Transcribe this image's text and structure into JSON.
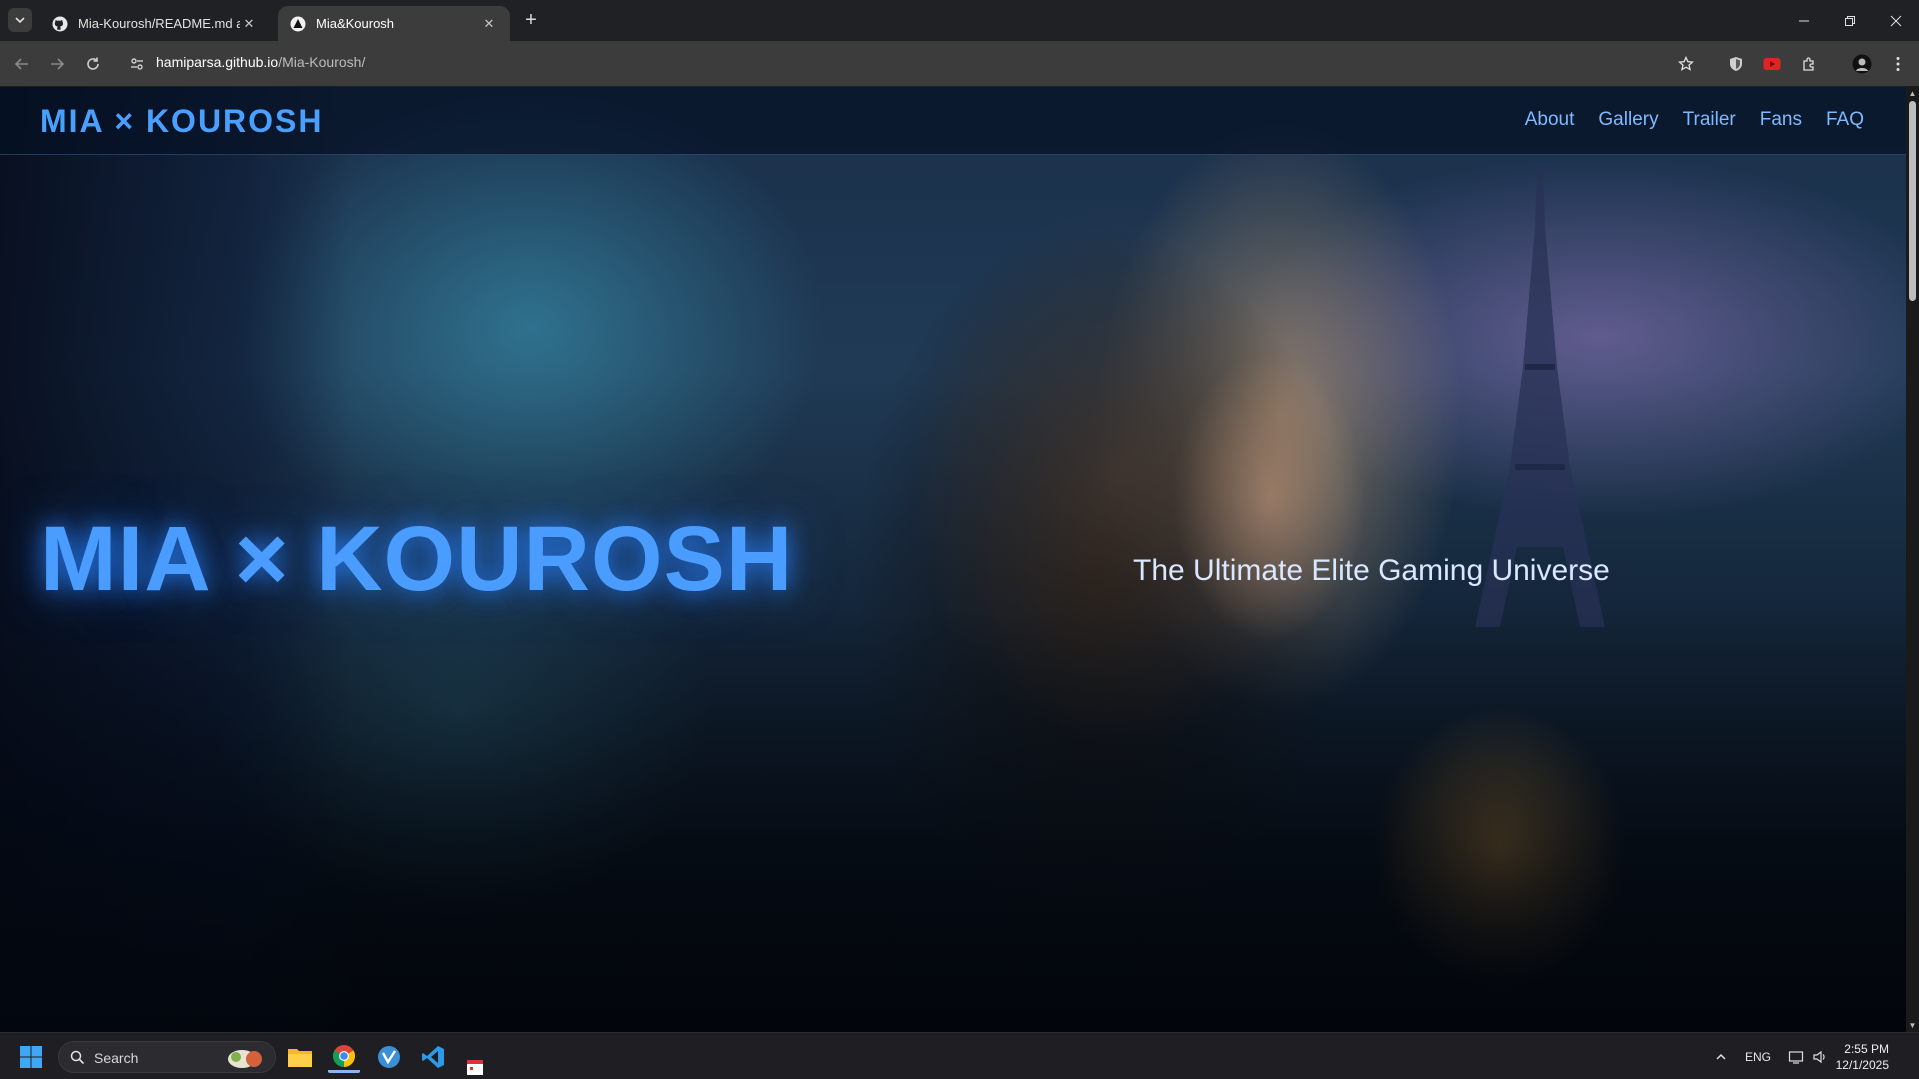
{
  "browser": {
    "tabs": [
      {
        "title": "Mia-Kourosh/README.md at m",
        "icon": "github-icon",
        "active": false
      },
      {
        "title": "Mia&Kourosh",
        "icon": "site-favicon-icon",
        "active": true
      }
    ],
    "new_tab_label": "+",
    "address": {
      "host": "hamiparsa.github.io",
      "path": "/Mia-Kourosh/"
    }
  },
  "site": {
    "logo": "MIA × KOUROSH",
    "nav": [
      {
        "label": "About"
      },
      {
        "label": "Gallery"
      },
      {
        "label": "Trailer"
      },
      {
        "label": "Fans"
      },
      {
        "label": "FAQ"
      }
    ],
    "hero": {
      "title": "MIA × KOUROSH",
      "tagline": "The Ultimate Elite Gaming Universe"
    },
    "accent_color": "#4a9dff"
  },
  "taskbar": {
    "search_placeholder": "Search",
    "language": "ENG",
    "time": "2:55 PM",
    "date": "12/1/2025"
  }
}
